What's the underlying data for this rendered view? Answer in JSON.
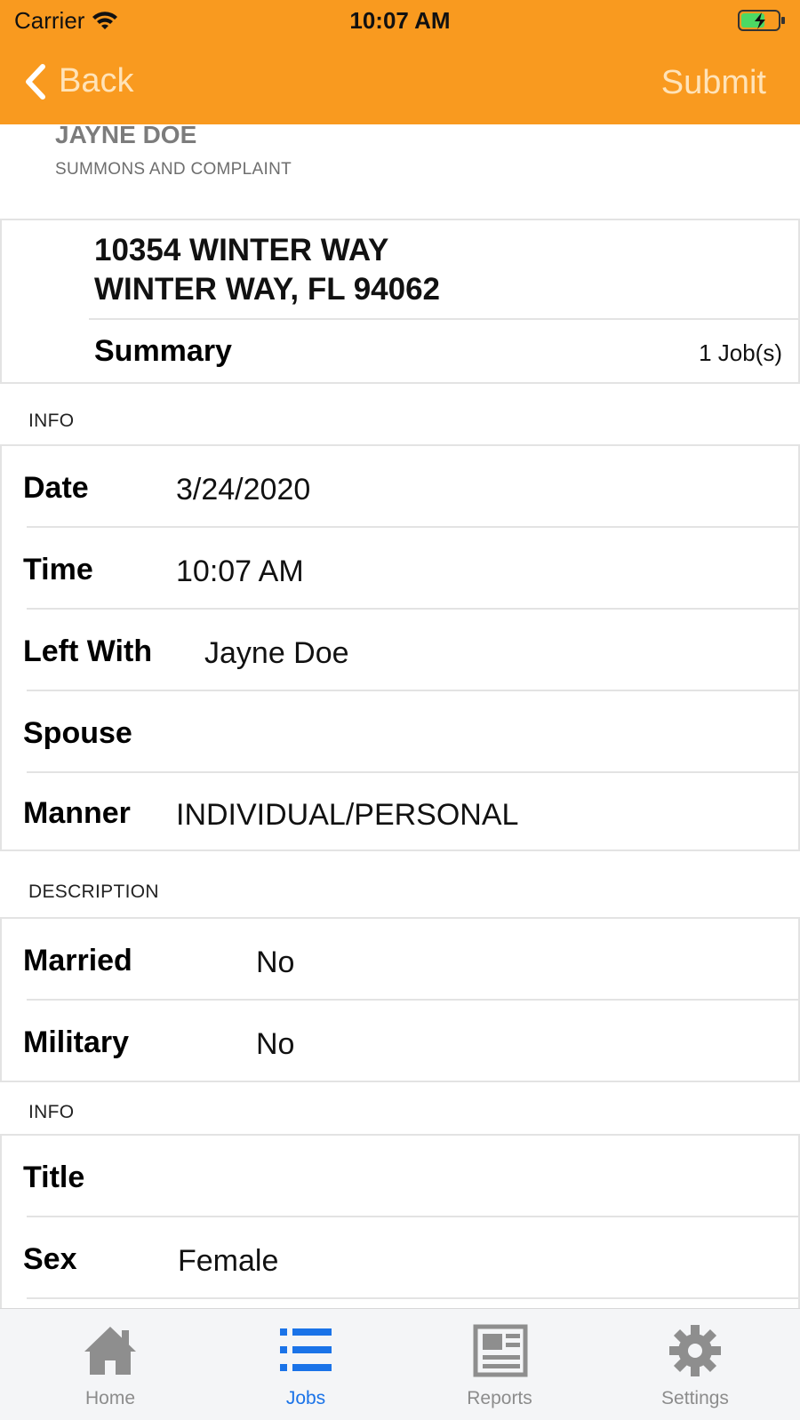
{
  "status_bar": {
    "carrier": "Carrier",
    "time": "10:07 AM"
  },
  "nav": {
    "back_label": "Back",
    "submit_label": "Submit"
  },
  "subject": {
    "name": "JAYNE DOE",
    "case_type": "SUMMONS AND COMPLAINT"
  },
  "address": {
    "line1": "10354 WINTER WAY",
    "line2": "WINTER WAY, FL 94062",
    "summary_label": "Summary",
    "jobs_count": "1 Job(s)"
  },
  "sections": {
    "info1_header": "INFO",
    "description_header": "DESCRIPTION",
    "info2_header": "INFO"
  },
  "info1": [
    {
      "label": "Date",
      "value": "3/24/2020"
    },
    {
      "label": "Time",
      "value": "10:07 AM"
    },
    {
      "label": "Left With",
      "value": "Jayne Doe"
    },
    {
      "label": "Spouse",
      "value": ""
    },
    {
      "label": "Manner",
      "value": "INDIVIDUAL/PERSONAL"
    }
  ],
  "description": [
    {
      "label": "Married",
      "value": "No"
    },
    {
      "label": "Military",
      "value": "No"
    }
  ],
  "info2": [
    {
      "label": "Title",
      "value": ""
    },
    {
      "label": "Sex",
      "value": "Female"
    }
  ],
  "tabs": [
    {
      "label": "Home",
      "icon": "home-icon"
    },
    {
      "label": "Jobs",
      "icon": "list-icon",
      "active": true
    },
    {
      "label": "Reports",
      "icon": "reports-icon"
    },
    {
      "label": "Settings",
      "icon": "gear-icon"
    }
  ],
  "colors": {
    "header_bg": "#f99a1f",
    "nav_text": "#ffe3b8",
    "tab_active": "#1a73e8",
    "tab_inactive": "#8c8c8c"
  }
}
